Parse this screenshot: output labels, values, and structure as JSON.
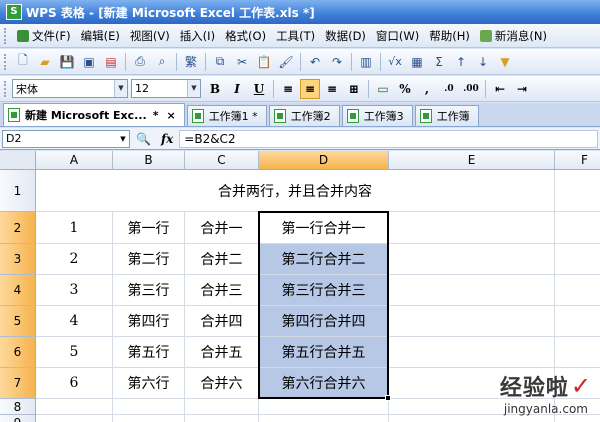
{
  "window": {
    "title": "WPS 表格 - [新建 Microsoft Excel 工作表.xls *]",
    "app_icon": "S"
  },
  "menu": {
    "items": [
      "文件(F)",
      "编辑(E)",
      "视图(V)",
      "插入(I)",
      "格式(O)",
      "工具(T)",
      "数据(D)",
      "窗口(W)",
      "帮助(H)",
      "新消息(N)"
    ]
  },
  "toolbar": {
    "font_name": "宋体",
    "font_size": "12",
    "bold": "B",
    "italic": "I",
    "underline": "U",
    "traditional": "繁",
    "percent": "%"
  },
  "doc_tabs": {
    "active": "新建 Microsoft Exc...",
    "active_marker": "*",
    "close": "×",
    "others": [
      "工作簿1 *",
      "工作簿2",
      "工作簿3",
      "工作簿"
    ]
  },
  "formula_bar": {
    "cell_ref": "D2",
    "fx": "fx",
    "formula": "=B2&C2"
  },
  "sheet": {
    "columns": [
      "A",
      "B",
      "C",
      "D",
      "E",
      "F"
    ],
    "selected_column": "D",
    "rows": [
      "1",
      "2",
      "3",
      "4",
      "5",
      "6",
      "7",
      "8",
      "9"
    ],
    "selected_rows": [
      "2",
      "3",
      "4",
      "5",
      "6",
      "7"
    ],
    "title_cell": "合并两行，并且合并内容",
    "data": [
      {
        "a": "1",
        "b": "第一行",
        "c": "合并一",
        "d": "第一行合并一"
      },
      {
        "a": "2",
        "b": "第二行",
        "c": "合并二",
        "d": "第二行合并二"
      },
      {
        "a": "3",
        "b": "第三行",
        "c": "合并三",
        "d": "第三行合并三"
      },
      {
        "a": "4",
        "b": "第四行",
        "c": "合并四",
        "d": "第四行合并四"
      },
      {
        "a": "5",
        "b": "第五行",
        "c": "合并五",
        "d": "第五行合并五"
      },
      {
        "a": "6",
        "b": "第六行",
        "c": "合并六",
        "d": "第六行合并六"
      }
    ]
  },
  "watermark": {
    "logo": "经验啦",
    "url": "jingyanla.com"
  },
  "colors": {
    "selection": "#b7c7e6",
    "header_selected": "#f6b34e",
    "titlebar": "#3f7fd8"
  }
}
